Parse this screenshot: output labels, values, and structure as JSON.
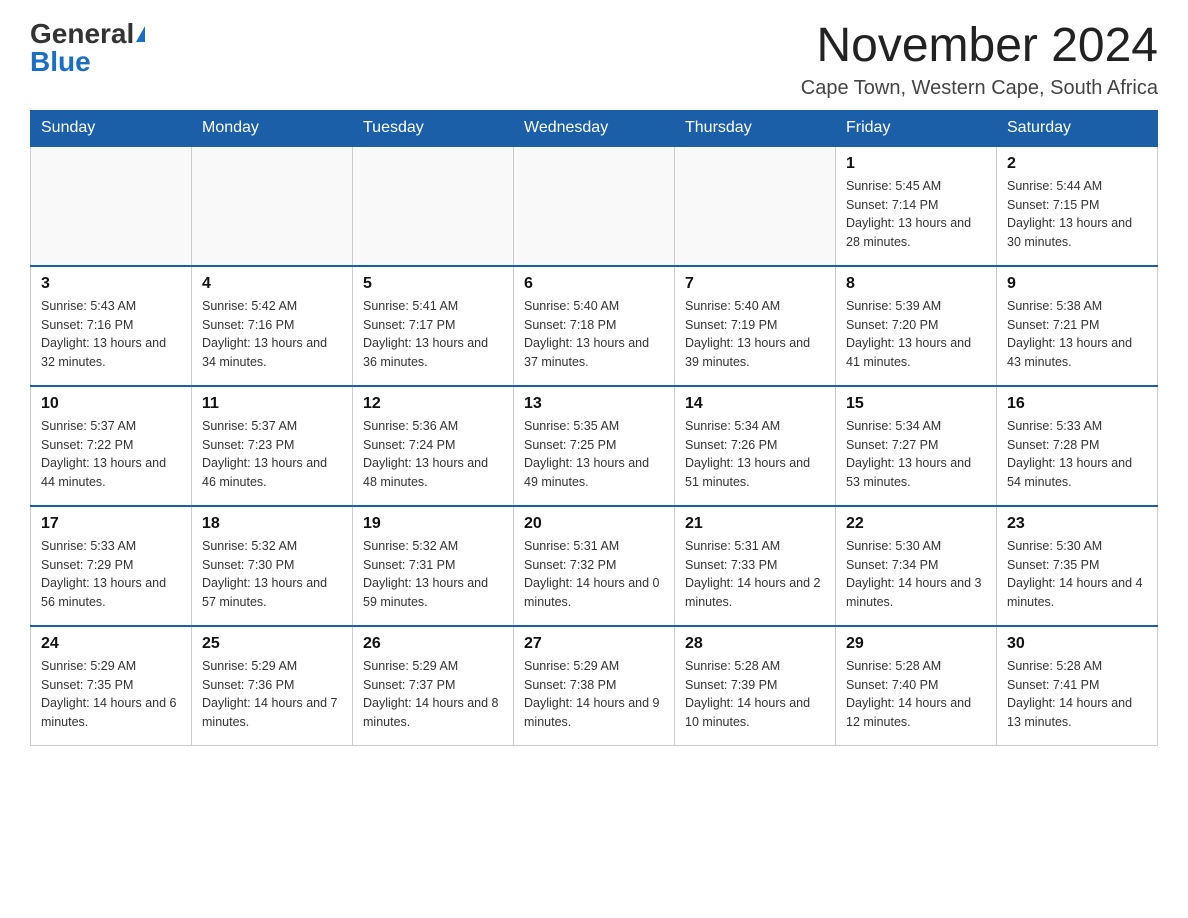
{
  "logo": {
    "general": "General",
    "blue": "Blue"
  },
  "header": {
    "month": "November 2024",
    "location": "Cape Town, Western Cape, South Africa"
  },
  "days_of_week": [
    "Sunday",
    "Monday",
    "Tuesday",
    "Wednesday",
    "Thursday",
    "Friday",
    "Saturday"
  ],
  "weeks": [
    [
      {
        "day": "",
        "info": ""
      },
      {
        "day": "",
        "info": ""
      },
      {
        "day": "",
        "info": ""
      },
      {
        "day": "",
        "info": ""
      },
      {
        "day": "",
        "info": ""
      },
      {
        "day": "1",
        "info": "Sunrise: 5:45 AM\nSunset: 7:14 PM\nDaylight: 13 hours and 28 minutes."
      },
      {
        "day": "2",
        "info": "Sunrise: 5:44 AM\nSunset: 7:15 PM\nDaylight: 13 hours and 30 minutes."
      }
    ],
    [
      {
        "day": "3",
        "info": "Sunrise: 5:43 AM\nSunset: 7:16 PM\nDaylight: 13 hours and 32 minutes."
      },
      {
        "day": "4",
        "info": "Sunrise: 5:42 AM\nSunset: 7:16 PM\nDaylight: 13 hours and 34 minutes."
      },
      {
        "day": "5",
        "info": "Sunrise: 5:41 AM\nSunset: 7:17 PM\nDaylight: 13 hours and 36 minutes."
      },
      {
        "day": "6",
        "info": "Sunrise: 5:40 AM\nSunset: 7:18 PM\nDaylight: 13 hours and 37 minutes."
      },
      {
        "day": "7",
        "info": "Sunrise: 5:40 AM\nSunset: 7:19 PM\nDaylight: 13 hours and 39 minutes."
      },
      {
        "day": "8",
        "info": "Sunrise: 5:39 AM\nSunset: 7:20 PM\nDaylight: 13 hours and 41 minutes."
      },
      {
        "day": "9",
        "info": "Sunrise: 5:38 AM\nSunset: 7:21 PM\nDaylight: 13 hours and 43 minutes."
      }
    ],
    [
      {
        "day": "10",
        "info": "Sunrise: 5:37 AM\nSunset: 7:22 PM\nDaylight: 13 hours and 44 minutes."
      },
      {
        "day": "11",
        "info": "Sunrise: 5:37 AM\nSunset: 7:23 PM\nDaylight: 13 hours and 46 minutes."
      },
      {
        "day": "12",
        "info": "Sunrise: 5:36 AM\nSunset: 7:24 PM\nDaylight: 13 hours and 48 minutes."
      },
      {
        "day": "13",
        "info": "Sunrise: 5:35 AM\nSunset: 7:25 PM\nDaylight: 13 hours and 49 minutes."
      },
      {
        "day": "14",
        "info": "Sunrise: 5:34 AM\nSunset: 7:26 PM\nDaylight: 13 hours and 51 minutes."
      },
      {
        "day": "15",
        "info": "Sunrise: 5:34 AM\nSunset: 7:27 PM\nDaylight: 13 hours and 53 minutes."
      },
      {
        "day": "16",
        "info": "Sunrise: 5:33 AM\nSunset: 7:28 PM\nDaylight: 13 hours and 54 minutes."
      }
    ],
    [
      {
        "day": "17",
        "info": "Sunrise: 5:33 AM\nSunset: 7:29 PM\nDaylight: 13 hours and 56 minutes."
      },
      {
        "day": "18",
        "info": "Sunrise: 5:32 AM\nSunset: 7:30 PM\nDaylight: 13 hours and 57 minutes."
      },
      {
        "day": "19",
        "info": "Sunrise: 5:32 AM\nSunset: 7:31 PM\nDaylight: 13 hours and 59 minutes."
      },
      {
        "day": "20",
        "info": "Sunrise: 5:31 AM\nSunset: 7:32 PM\nDaylight: 14 hours and 0 minutes."
      },
      {
        "day": "21",
        "info": "Sunrise: 5:31 AM\nSunset: 7:33 PM\nDaylight: 14 hours and 2 minutes."
      },
      {
        "day": "22",
        "info": "Sunrise: 5:30 AM\nSunset: 7:34 PM\nDaylight: 14 hours and 3 minutes."
      },
      {
        "day": "23",
        "info": "Sunrise: 5:30 AM\nSunset: 7:35 PM\nDaylight: 14 hours and 4 minutes."
      }
    ],
    [
      {
        "day": "24",
        "info": "Sunrise: 5:29 AM\nSunset: 7:35 PM\nDaylight: 14 hours and 6 minutes."
      },
      {
        "day": "25",
        "info": "Sunrise: 5:29 AM\nSunset: 7:36 PM\nDaylight: 14 hours and 7 minutes."
      },
      {
        "day": "26",
        "info": "Sunrise: 5:29 AM\nSunset: 7:37 PM\nDaylight: 14 hours and 8 minutes."
      },
      {
        "day": "27",
        "info": "Sunrise: 5:29 AM\nSunset: 7:38 PM\nDaylight: 14 hours and 9 minutes."
      },
      {
        "day": "28",
        "info": "Sunrise: 5:28 AM\nSunset: 7:39 PM\nDaylight: 14 hours and 10 minutes."
      },
      {
        "day": "29",
        "info": "Sunrise: 5:28 AM\nSunset: 7:40 PM\nDaylight: 14 hours and 12 minutes."
      },
      {
        "day": "30",
        "info": "Sunrise: 5:28 AM\nSunset: 7:41 PM\nDaylight: 14 hours and 13 minutes."
      }
    ]
  ]
}
